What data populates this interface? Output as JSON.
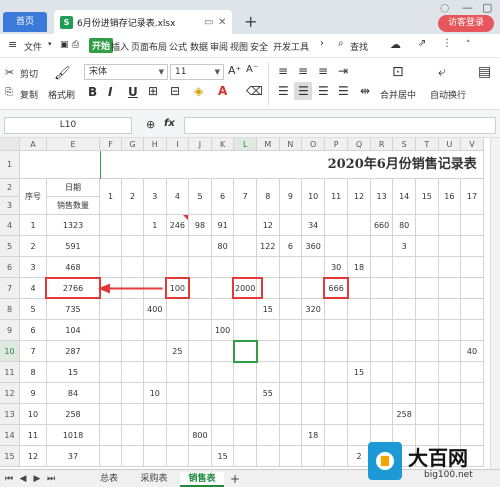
{
  "titlebar": {
    "home_tab": "首页",
    "file_tab": "6月份进销存记录表.xlsx",
    "file_badge": "S",
    "new_tab": "+",
    "login": "访客登录"
  },
  "menubar": {
    "hamburger": "≡",
    "file_menu": "文件",
    "items": [
      "开始",
      "插入",
      "页面布局",
      "公式",
      "数据",
      "审阅",
      "视图",
      "安全",
      "开发工具"
    ],
    "active": "开始",
    "search": "查找"
  },
  "ribbon": {
    "cut": "剪切",
    "copy": "复制",
    "format_painter": "格式刷",
    "font_name": "宋体",
    "font_size": "11",
    "merge": "合并居中",
    "wrap": "自动换行",
    "bold": "B",
    "italic": "I",
    "underline": "U"
  },
  "formulabar": {
    "cell_ref": "L10",
    "fx": "fx"
  },
  "sheet": {
    "title": "2020年6月份销售记录表",
    "columns": [
      "A",
      "E",
      "F",
      "G",
      "H",
      "I",
      "J",
      "K",
      "L",
      "M",
      "N",
      "O",
      "P",
      "Q",
      "R",
      "S",
      "T",
      "U",
      "V"
    ],
    "day_headers": [
      "1",
      "2",
      "3",
      "4",
      "5",
      "6",
      "7",
      "8",
      "9",
      "10",
      "11",
      "12",
      "13",
      "14",
      "15",
      "16",
      "17"
    ],
    "header_seq": "序号",
    "header_date": "日期",
    "header_qty": "销售数量",
    "row_numbers": [
      "1",
      "2",
      "3",
      "4",
      "5",
      "6",
      "7",
      "8",
      "9",
      "10",
      "11",
      "12",
      "13",
      "14",
      "15"
    ],
    "rows": [
      {
        "seq": "1",
        "qty": "1323",
        "days": [
          "",
          "",
          "1",
          "246",
          "98",
          "91",
          "",
          "12",
          "",
          "34",
          "",
          "",
          "660",
          "80",
          "",
          "",
          ""
        ]
      },
      {
        "seq": "2",
        "qty": "591",
        "days": [
          "",
          "",
          "",
          "",
          "",
          "80",
          "",
          "122",
          "6",
          "360",
          "",
          "",
          "",
          "3",
          "",
          "",
          ""
        ]
      },
      {
        "seq": "3",
        "qty": "468",
        "days": [
          "",
          "",
          "",
          "",
          "",
          "",
          "",
          "",
          "",
          "",
          "30",
          "18",
          "",
          "",
          "",
          "",
          ""
        ]
      },
      {
        "seq": "4",
        "qty": "2766",
        "days": [
          "",
          "",
          "",
          "100",
          "",
          "",
          "2000",
          "",
          "",
          "",
          "666",
          "",
          "",
          "",
          "",
          "",
          ""
        ]
      },
      {
        "seq": "5",
        "qty": "735",
        "days": [
          "",
          "",
          "400",
          "",
          "",
          "",
          "",
          "15",
          "",
          "320",
          "",
          "",
          "",
          "",
          "",
          "",
          ""
        ]
      },
      {
        "seq": "6",
        "qty": "104",
        "days": [
          "",
          "",
          "",
          "",
          "",
          "100",
          "",
          "",
          "",
          "",
          "",
          "",
          "",
          "",
          "",
          "",
          ""
        ]
      },
      {
        "seq": "7",
        "qty": "287",
        "days": [
          "",
          "",
          "",
          "25",
          "",
          "",
          "",
          "",
          "",
          "",
          "",
          "",
          "",
          "",
          "",
          "",
          "40"
        ]
      },
      {
        "seq": "8",
        "qty": "15",
        "days": [
          "",
          "",
          "",
          "",
          "",
          "",
          "",
          "",
          "",
          "",
          "",
          "15",
          "",
          "",
          "",
          "",
          ""
        ]
      },
      {
        "seq": "9",
        "qty": "84",
        "days": [
          "",
          "",
          "10",
          "",
          "",
          "",
          "",
          "55",
          "",
          "",
          "",
          "",
          "",
          "",
          "",
          "",
          ""
        ]
      },
      {
        "seq": "10",
        "qty": "258",
        "days": [
          "",
          "",
          "",
          "",
          "",
          "",
          "",
          "",
          "",
          "",
          "",
          "",
          "",
          "258",
          "",
          "",
          ""
        ]
      },
      {
        "seq": "11",
        "qty": "1018",
        "days": [
          "",
          "",
          "",
          "",
          "800",
          "",
          "",
          "",
          "",
          "18",
          "",
          "",
          "",
          "",
          "",
          "",
          ""
        ]
      },
      {
        "seq": "12",
        "qty": "37",
        "days": [
          "",
          "",
          "",
          "",
          "",
          "15",
          "",
          "",
          "",
          "",
          "",
          "2",
          "",
          "",
          "",
          "",
          ""
        ]
      }
    ]
  },
  "sheettabs": {
    "tabs": [
      "总表",
      "采购表",
      "销售表"
    ],
    "active": "销售表",
    "add": "+"
  },
  "watermark": {
    "text": "大百网",
    "sub": "big100.net"
  },
  "colors": {
    "accent": "#2f9e44",
    "highlight": "#e03a3a",
    "home_tab": "#3b7ad9",
    "login": "#e6565a"
  }
}
